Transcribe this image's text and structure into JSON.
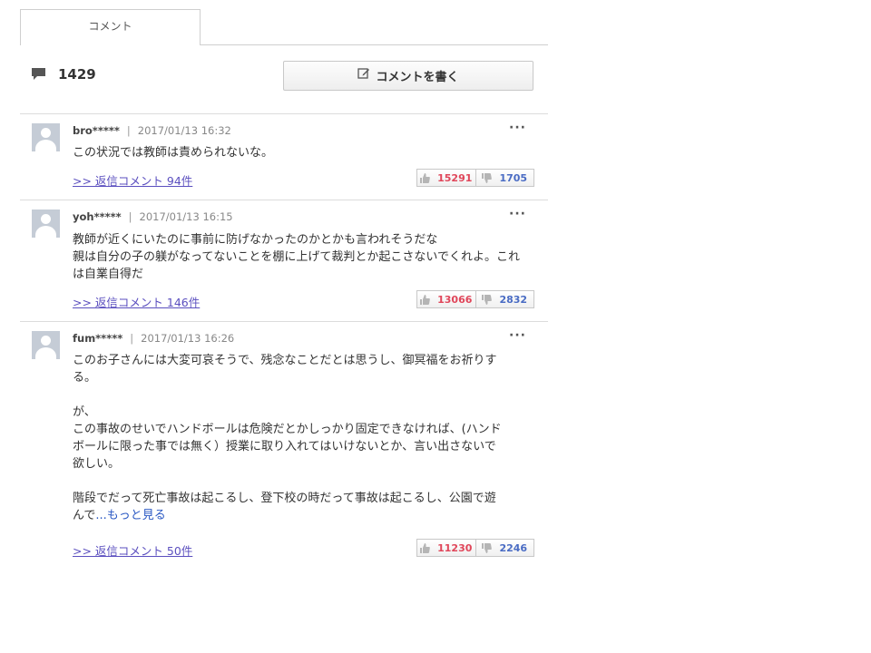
{
  "tabs": {
    "comments_label": "コメント"
  },
  "summary": {
    "comment_count": "1429",
    "write_button_label": "コメントを書く"
  },
  "comments": [
    {
      "user": "bro*****",
      "date": "2017/01/13 16:32",
      "lines": [
        "この状況では教師は責められないな。"
      ],
      "reply_link": ">> 返信コメント 94件",
      "likes": "15291",
      "dislikes": "1705"
    },
    {
      "user": "yoh*****",
      "date": "2017/01/13 16:15",
      "lines": [
        "教師が近くにいたのに事前に防げなかったのかとかも言われそうだな",
        "親は自分の子の躾がなってないことを棚に上げて裁判とか起こさないでくれよ。これ",
        "は自業自得だ"
      ],
      "reply_link": ">> 返信コメント 146件",
      "likes": "13066",
      "dislikes": "2832"
    },
    {
      "user": "fum*****",
      "date": "2017/01/13 16:26",
      "lines": [
        "このお子さんには大変可哀そうで、残念なことだとは思うし、御冥福をお祈りす",
        "る。",
        "",
        "が、",
        "この事故のせいでハンドボールは危険だとかしっかり固定できなければ、(ハンド",
        "ボールに限った事では無く）授業に取り入れてはいけないとか、言い出さないで",
        "欲しい。",
        "",
        "階段でだって死亡事故は起こるし、登下校の時だって事故は起こるし、公園で遊",
        "んで"
      ],
      "more_link": "...もっと見る",
      "reply_link": ">> 返信コメント 50件",
      "likes": "11230",
      "dislikes": "2246"
    }
  ],
  "colors": {
    "like": "#e0465a",
    "dislike": "#4a6cc4",
    "reply_link": "#5b4fbf",
    "more_link": "#2b59c3"
  }
}
